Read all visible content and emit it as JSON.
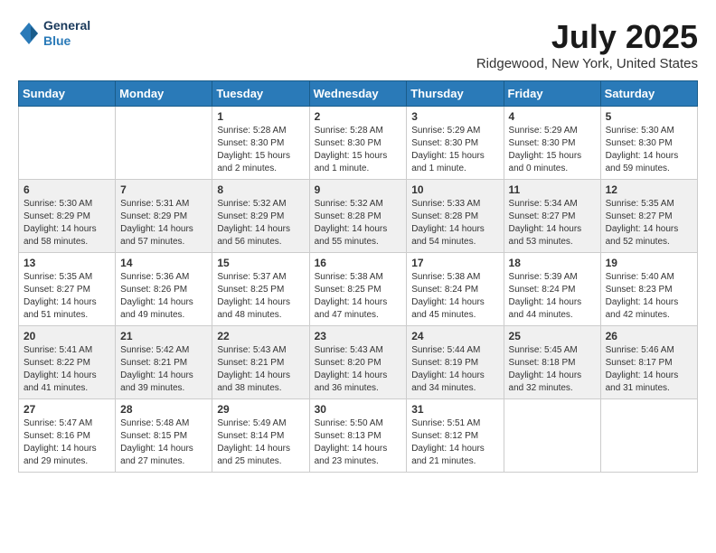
{
  "header": {
    "logo_general": "General",
    "logo_blue": "Blue",
    "title": "July 2025",
    "location": "Ridgewood, New York, United States"
  },
  "weekdays": [
    "Sunday",
    "Monday",
    "Tuesday",
    "Wednesday",
    "Thursday",
    "Friday",
    "Saturday"
  ],
  "weeks": [
    [
      null,
      null,
      {
        "day": 1,
        "sunrise": "5:28 AM",
        "sunset": "8:30 PM",
        "daylight": "15 hours and 2 minutes."
      },
      {
        "day": 2,
        "sunrise": "5:28 AM",
        "sunset": "8:30 PM",
        "daylight": "15 hours and 1 minute."
      },
      {
        "day": 3,
        "sunrise": "5:29 AM",
        "sunset": "8:30 PM",
        "daylight": "15 hours and 1 minute."
      },
      {
        "day": 4,
        "sunrise": "5:29 AM",
        "sunset": "8:30 PM",
        "daylight": "15 hours and 0 minutes."
      },
      {
        "day": 5,
        "sunrise": "5:30 AM",
        "sunset": "8:30 PM",
        "daylight": "14 hours and 59 minutes."
      }
    ],
    [
      {
        "day": 6,
        "sunrise": "5:30 AM",
        "sunset": "8:29 PM",
        "daylight": "14 hours and 58 minutes."
      },
      {
        "day": 7,
        "sunrise": "5:31 AM",
        "sunset": "8:29 PM",
        "daylight": "14 hours and 57 minutes."
      },
      {
        "day": 8,
        "sunrise": "5:32 AM",
        "sunset": "8:29 PM",
        "daylight": "14 hours and 56 minutes."
      },
      {
        "day": 9,
        "sunrise": "5:32 AM",
        "sunset": "8:28 PM",
        "daylight": "14 hours and 55 minutes."
      },
      {
        "day": 10,
        "sunrise": "5:33 AM",
        "sunset": "8:28 PM",
        "daylight": "14 hours and 54 minutes."
      },
      {
        "day": 11,
        "sunrise": "5:34 AM",
        "sunset": "8:27 PM",
        "daylight": "14 hours and 53 minutes."
      },
      {
        "day": 12,
        "sunrise": "5:35 AM",
        "sunset": "8:27 PM",
        "daylight": "14 hours and 52 minutes."
      }
    ],
    [
      {
        "day": 13,
        "sunrise": "5:35 AM",
        "sunset": "8:27 PM",
        "daylight": "14 hours and 51 minutes."
      },
      {
        "day": 14,
        "sunrise": "5:36 AM",
        "sunset": "8:26 PM",
        "daylight": "14 hours and 49 minutes."
      },
      {
        "day": 15,
        "sunrise": "5:37 AM",
        "sunset": "8:25 PM",
        "daylight": "14 hours and 48 minutes."
      },
      {
        "day": 16,
        "sunrise": "5:38 AM",
        "sunset": "8:25 PM",
        "daylight": "14 hours and 47 minutes."
      },
      {
        "day": 17,
        "sunrise": "5:38 AM",
        "sunset": "8:24 PM",
        "daylight": "14 hours and 45 minutes."
      },
      {
        "day": 18,
        "sunrise": "5:39 AM",
        "sunset": "8:24 PM",
        "daylight": "14 hours and 44 minutes."
      },
      {
        "day": 19,
        "sunrise": "5:40 AM",
        "sunset": "8:23 PM",
        "daylight": "14 hours and 42 minutes."
      }
    ],
    [
      {
        "day": 20,
        "sunrise": "5:41 AM",
        "sunset": "8:22 PM",
        "daylight": "14 hours and 41 minutes."
      },
      {
        "day": 21,
        "sunrise": "5:42 AM",
        "sunset": "8:21 PM",
        "daylight": "14 hours and 39 minutes."
      },
      {
        "day": 22,
        "sunrise": "5:43 AM",
        "sunset": "8:21 PM",
        "daylight": "14 hours and 38 minutes."
      },
      {
        "day": 23,
        "sunrise": "5:43 AM",
        "sunset": "8:20 PM",
        "daylight": "14 hours and 36 minutes."
      },
      {
        "day": 24,
        "sunrise": "5:44 AM",
        "sunset": "8:19 PM",
        "daylight": "14 hours and 34 minutes."
      },
      {
        "day": 25,
        "sunrise": "5:45 AM",
        "sunset": "8:18 PM",
        "daylight": "14 hours and 32 minutes."
      },
      {
        "day": 26,
        "sunrise": "5:46 AM",
        "sunset": "8:17 PM",
        "daylight": "14 hours and 31 minutes."
      }
    ],
    [
      {
        "day": 27,
        "sunrise": "5:47 AM",
        "sunset": "8:16 PM",
        "daylight": "14 hours and 29 minutes."
      },
      {
        "day": 28,
        "sunrise": "5:48 AM",
        "sunset": "8:15 PM",
        "daylight": "14 hours and 27 minutes."
      },
      {
        "day": 29,
        "sunrise": "5:49 AM",
        "sunset": "8:14 PM",
        "daylight": "14 hours and 25 minutes."
      },
      {
        "day": 30,
        "sunrise": "5:50 AM",
        "sunset": "8:13 PM",
        "daylight": "14 hours and 23 minutes."
      },
      {
        "day": 31,
        "sunrise": "5:51 AM",
        "sunset": "8:12 PM",
        "daylight": "14 hours and 21 minutes."
      },
      null,
      null
    ]
  ],
  "labels": {
    "sunrise_prefix": "Sunrise: ",
    "sunset_prefix": "Sunset: ",
    "daylight_prefix": "Daylight: "
  }
}
